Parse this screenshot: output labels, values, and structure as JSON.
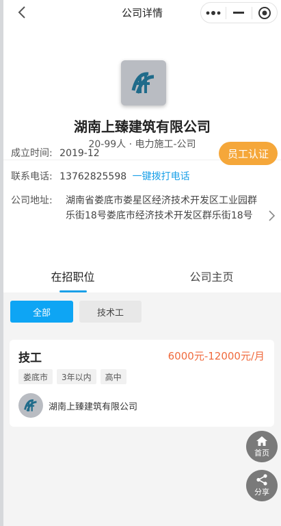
{
  "nav": {
    "title": "公司详情"
  },
  "company": {
    "name": "湖南上臻建筑有限公司",
    "meta": "20-99人 · 电力施工-公司"
  },
  "info": {
    "date_label": "成立时间:",
    "date_value": "2019-12",
    "phone_label": "联系电话:",
    "phone_value": "13762825598",
    "call_link": "一键拨打电话",
    "address_label": "公司地址:",
    "address_value": "湖南省娄底市娄星区经济技术开发区工业园群乐街18号娄底市经济技术开发区群乐街18号",
    "verify_button": "员工认证"
  },
  "tabs": [
    {
      "label": "在招职位",
      "active": true
    },
    {
      "label": "公司主页",
      "active": false
    }
  ],
  "filters": [
    {
      "label": "全部",
      "active": true
    },
    {
      "label": "技术工",
      "active": false
    }
  ],
  "jobs": [
    {
      "title": "技工",
      "salary": "6000元-12000元/月",
      "tags": [
        "娄底市",
        "3年以内",
        "高中"
      ],
      "company": "湖南上臻建筑有限公司"
    }
  ],
  "fab": {
    "home_label": "首页",
    "share_label": "分享"
  },
  "colors": {
    "accent_blue": "#0ea5f4",
    "link_blue": "#1aa0e8",
    "verify_orange": "#f5a73a",
    "salary_orange": "#f06a3d",
    "fab_gray": "#7a7a7a"
  },
  "icons": {
    "back": "chevron-left-icon",
    "more": "more-dots-icon",
    "minimize": "minimize-icon",
    "close": "target-circle-icon",
    "logo": "company-logo-icon",
    "address_arrow": "chevron-right-icon",
    "home": "home-icon",
    "share": "share-icon"
  }
}
